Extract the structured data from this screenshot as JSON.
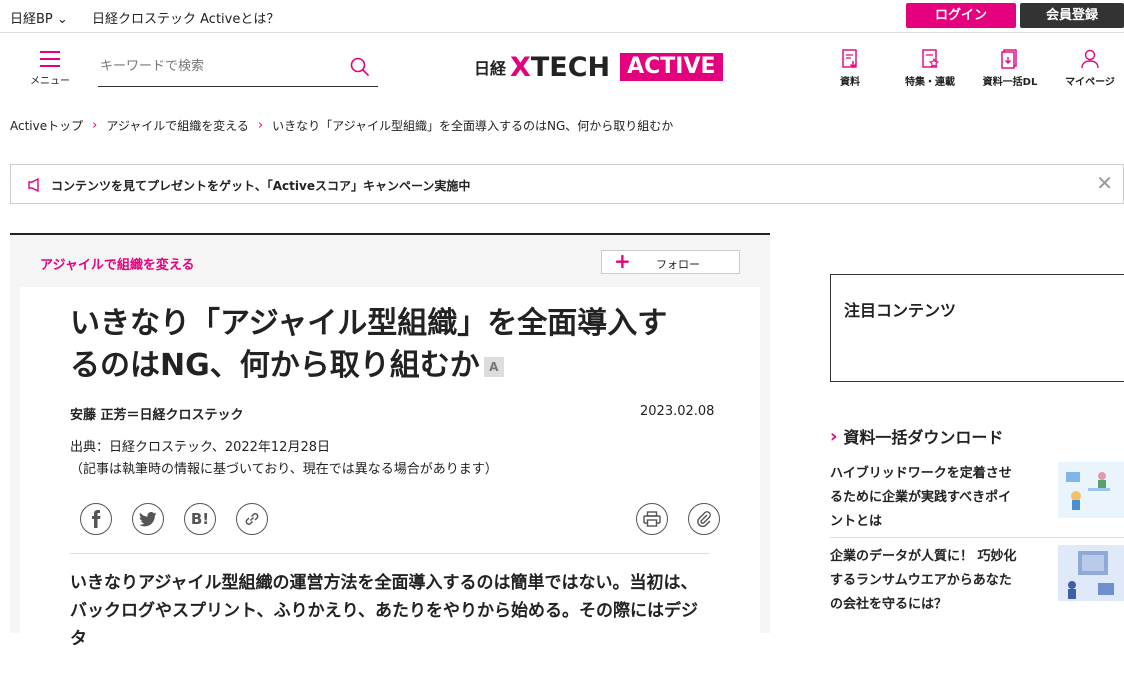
{
  "topbar": {
    "nikkei_bp": "日経BP ⌄",
    "about": "日経クロステック Activeとは？",
    "login": "ログイン",
    "register": "会員登録"
  },
  "header": {
    "menu_label": "メニュー",
    "search_placeholder": "キーワードで検索",
    "logo_nikkei": "日経",
    "logo_xtech_x": "X",
    "logo_xtech_rest": "TECH",
    "logo_active": "ACTIVE",
    "icons": [
      {
        "label": "資料",
        "icon": "document-download-icon"
      },
      {
        "label": "特集・連載",
        "icon": "feature-series-icon"
      },
      {
        "label": "資料一括DL",
        "icon": "bulk-download-icon"
      },
      {
        "label": "マイページ",
        "icon": "user-icon"
      }
    ]
  },
  "breadcrumb": [
    "Activeトップ",
    "アジャイルで組織を変える",
    "いきなり「アジャイル型組織」を全面導入するのはNG、何から取り組むか"
  ],
  "campaign": {
    "text": "コンテンツを見てプレゼントをゲット、「Activeスコア」キャンペーン実施中",
    "close": "✕"
  },
  "article": {
    "series": "アジャイルで組織を変える",
    "follow": "フォロー",
    "follow_plus": "+",
    "title_line1": "いきなり「アジャイル型組織」を全面導入す",
    "title_line2": "るのはNG、何から取り組むか",
    "badge": "A",
    "author": "安藤 正芳＝日経クロステック",
    "date": "2023.02.08",
    "source": "出典：日経クロステック、2022年12月28日",
    "note": "（記事は執筆時の情報に基づいており、現在では異なる場合があります）",
    "hatena": "B!",
    "lead_line1": "いきなりアジャイル型組織の運営方法を全面導入するのは簡単ではない。当初は、",
    "lead_line2": "バックログやスプリント、ふりかえり、あたりをやりから始める。その際にはデジタ"
  },
  "sidebar": {
    "featured_title": "注目コンテンツ",
    "download_title": "資料一括ダウンロード",
    "download_chevron": "›",
    "downloads": [
      {
        "line1": "ハイブリッドワークを定着させ",
        "line2": "るために企業が実践すべきポイ",
        "line3": "ントとは"
      },
      {
        "line1": "企業のデータが人質に！ 巧妙化",
        "line2": "するランサムウエアからあなた",
        "line3": "の会社を守るには？"
      }
    ]
  }
}
